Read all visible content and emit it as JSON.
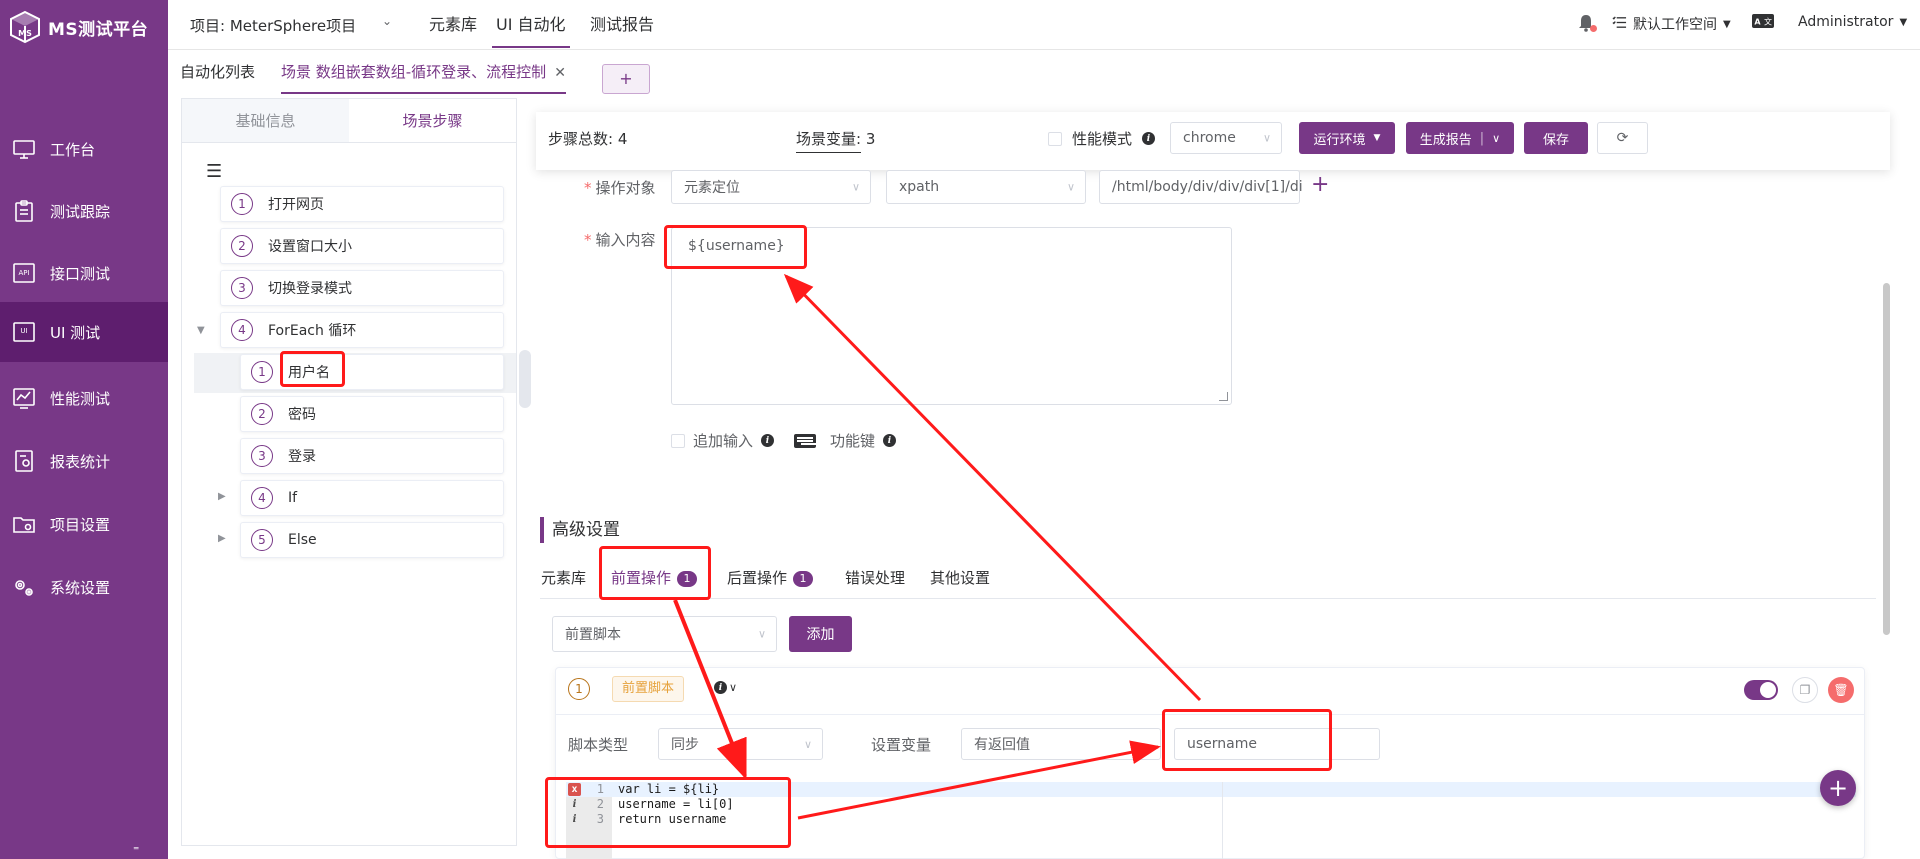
{
  "sidebar": {
    "logo_text": "MS测试平台",
    "items": [
      {
        "label": "工作台",
        "icon": "monitor-icon"
      },
      {
        "label": "测试跟踪",
        "icon": "clipboard-icon"
      },
      {
        "label": "接口测试",
        "icon": "api-icon"
      },
      {
        "label": "UI 测试",
        "icon": "ui-icon"
      },
      {
        "label": "性能测试",
        "icon": "chart-monitor-icon"
      },
      {
        "label": "报表统计",
        "icon": "report-icon"
      },
      {
        "label": "项目设置",
        "icon": "folder-settings-icon"
      },
      {
        "label": "系统设置",
        "icon": "gears-icon"
      }
    ],
    "active_index": 3,
    "bottom_glyph": "⁼"
  },
  "header": {
    "project": "项目: MeterSphere项目",
    "menu": [
      "元素库",
      "UI 自动化",
      "测试报告"
    ],
    "active_menu": 1,
    "workspace": "默认工作空间",
    "user": "Administrator"
  },
  "tabs": {
    "list_label": "自动化列表",
    "active_tab": "场景 数组嵌套数组-循环登录、流程控制",
    "add": "+"
  },
  "left_panel": {
    "tabs": [
      "基础信息",
      "场景步骤"
    ],
    "active_tab": 1,
    "steps": [
      {
        "num": "1",
        "label": "打开网页"
      },
      {
        "num": "2",
        "label": "设置窗口大小"
      },
      {
        "num": "3",
        "label": "切换登录模式"
      },
      {
        "num": "4",
        "label": "ForEach 循环"
      }
    ],
    "children": [
      {
        "num": "1",
        "label": "用户名"
      },
      {
        "num": "2",
        "label": "密码"
      },
      {
        "num": "3",
        "label": "登录"
      },
      {
        "num": "4",
        "label": "If"
      },
      {
        "num": "5",
        "label": "Else"
      }
    ]
  },
  "toolbar": {
    "step_total_label": "步骤总数:",
    "step_total": "4",
    "scene_var_label": "场景变量:",
    "scene_var": "3",
    "perf_mode": "性能模式",
    "browser": "chrome",
    "run_env": "运行环境",
    "gen_report": "生成报告",
    "save": "保存"
  },
  "form": {
    "op_target_label": "操作对象",
    "locator_type": "元素定位",
    "locator_method": "xpath",
    "locator_value": "/html/body/div/div/div[1]/di",
    "input_label": "输入内容",
    "input_value": "${username}",
    "append_input": "追加输入",
    "function_key": "功能键"
  },
  "advanced": {
    "title": "高级设置",
    "tabs": [
      {
        "label": "元素库",
        "badge": ""
      },
      {
        "label": "前置操作",
        "badge": "1"
      },
      {
        "label": "后置操作",
        "badge": "1"
      },
      {
        "label": "错误处理",
        "badge": ""
      },
      {
        "label": "其他设置",
        "badge": ""
      }
    ],
    "active_tab": 1,
    "pre_select": "前置脚本",
    "add_button": "添加"
  },
  "script": {
    "num": "1",
    "tag": "前置脚本",
    "script_type_label": "脚本类型",
    "script_type": "同步",
    "set_var_label": "设置变量",
    "return_mode": "有返回值",
    "var_name": "username",
    "lines": [
      {
        "ln": "1",
        "mark": "x",
        "code": "var li = ${li}"
      },
      {
        "ln": "2",
        "mark": "i",
        "code": "username = li[0]"
      },
      {
        "ln": "3",
        "mark": "i",
        "code": "return username"
      }
    ]
  },
  "colors": {
    "brand": "#783887",
    "annotation": "#ff1a1a",
    "tag_orange": "#e6a23c",
    "danger": "#f56c6c"
  }
}
